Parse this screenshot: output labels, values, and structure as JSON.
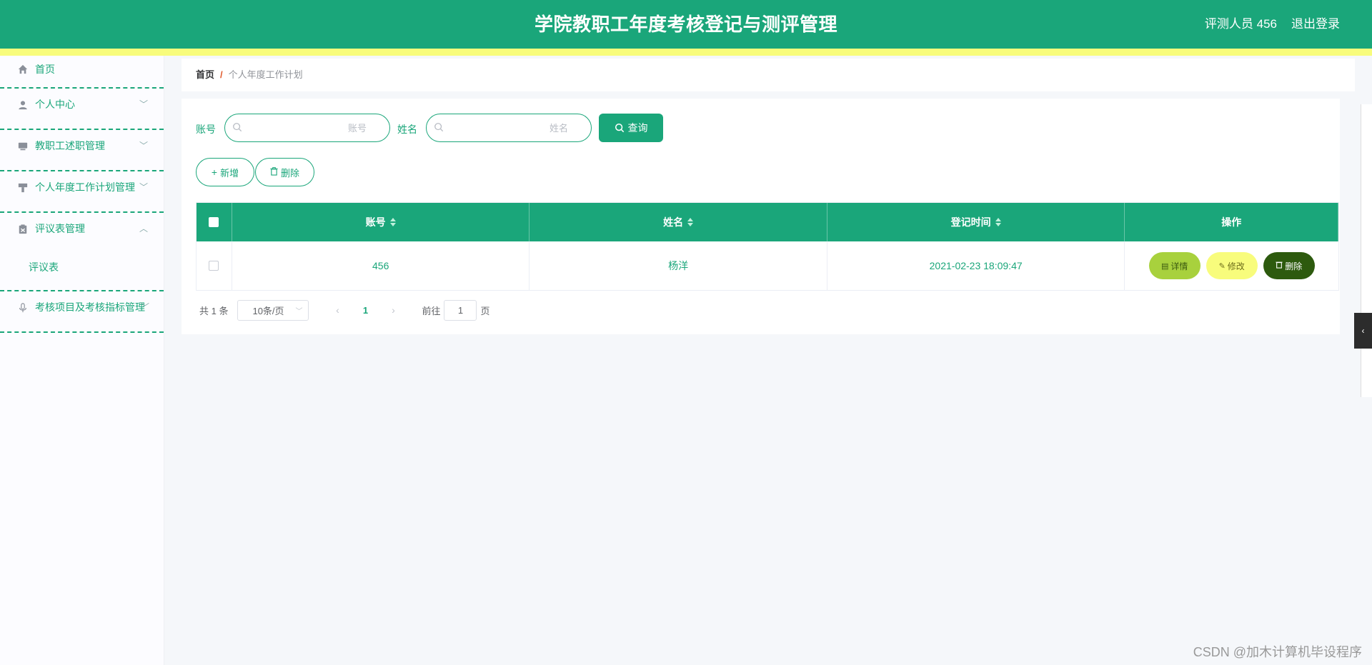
{
  "header": {
    "title": "学院教职工年度考核登记与测评管理",
    "user": "评测人员 456",
    "logout": "退出登录",
    "color": "#1aa67a",
    "strip_color": "#f8fc7c"
  },
  "sidebar": {
    "items": [
      {
        "label": "首页",
        "icon": "home-icon"
      },
      {
        "label": "个人中心",
        "icon": "user-icon"
      },
      {
        "label": "教职工述职管理",
        "icon": "monitor-icon"
      },
      {
        "label": "个人年度工作计划管理",
        "icon": "brush-icon"
      },
      {
        "label": "评议表管理",
        "icon": "clipboard-icon",
        "sub": [
          "评议表"
        ]
      },
      {
        "label": "考核项目及考核指标管理",
        "icon": "microphone-icon"
      }
    ]
  },
  "breadcrumb": {
    "home": "首页",
    "sep": "/",
    "current": "个人年度工作计划"
  },
  "search": {
    "account_label": "账号",
    "account_placeholder": "账号",
    "name_label": "姓名",
    "name_placeholder": "姓名",
    "query_label": "查询"
  },
  "actions": {
    "add_label": "新增",
    "delete_label": "删除"
  },
  "table": {
    "headers": {
      "account": "账号",
      "name": "姓名",
      "time": "登记时间",
      "ops": "操作"
    },
    "rows": [
      {
        "account": "456",
        "name": "杨洋",
        "time": "2021-02-23 18:09:47"
      }
    ],
    "ops": {
      "detail": "详情",
      "edit": "修改",
      "delete": "删除"
    }
  },
  "pagination": {
    "total": "共 1 条",
    "page_size": "10条/页",
    "current": "1",
    "goto_label": "前往",
    "goto_value": "1",
    "page_suffix": "页"
  },
  "watermark": "CSDN @加木计算机毕设程序"
}
